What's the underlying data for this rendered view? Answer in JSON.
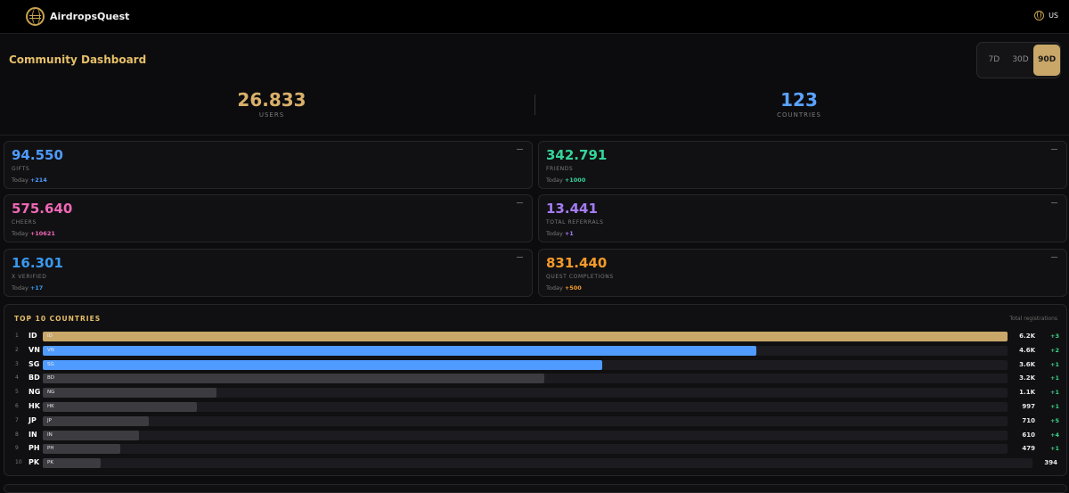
{
  "app": {
    "name": "AirdropsQuest",
    "language": "US"
  },
  "dashboard": {
    "title": "Community Dashboard",
    "periods": [
      "7D",
      "30D",
      "90D"
    ],
    "active_period": "90D"
  },
  "hero": {
    "users": {
      "value": "26.833",
      "label": "USERS",
      "color": "#d9b06a"
    },
    "countries": {
      "value": "123",
      "label": "COUNTRIES",
      "color": "#5aa2ff"
    }
  },
  "stats": [
    {
      "value": "94.550",
      "label": "GIFTS",
      "today_label": "Today",
      "today": "+214",
      "color": "#4f9bff"
    },
    {
      "value": "342.791",
      "label": "FRIENDS",
      "today_label": "Today",
      "today": "+1000",
      "color": "#35d59a"
    },
    {
      "value": "575.640",
      "label": "CHEERS",
      "today_label": "Today",
      "today": "+10621",
      "color": "#f067b6"
    },
    {
      "value": "13.441",
      "label": "TOTAL REFERRALS",
      "today_label": "Today",
      "today": "+1",
      "color": "#a57cf5"
    },
    {
      "value": "16.301",
      "label": "X VERIFIED",
      "today_label": "Today",
      "today": "+17",
      "color": "#3a98f0"
    },
    {
      "value": "831.440",
      "label": "QUEST COMPLETIONS",
      "today_label": "Today",
      "today": "+500",
      "color": "#f59a2a"
    }
  ],
  "top_countries": {
    "title": "TOP 10 COUNTRIES",
    "subtitle": "Total registrations",
    "rows": [
      {
        "rank": "1",
        "code": "ID",
        "value": "6.2K",
        "change": "+3",
        "fraction": 1.0,
        "color": "#c9a768"
      },
      {
        "rank": "2",
        "code": "VN",
        "value": "4.6K",
        "change": "+2",
        "fraction": 0.74,
        "color": "#4f9bff"
      },
      {
        "rank": "3",
        "code": "SG",
        "value": "3.6K",
        "change": "+1",
        "fraction": 0.58,
        "color": "#4f9bff"
      },
      {
        "rank": "4",
        "code": "BD",
        "value": "3.2K",
        "change": "+1",
        "fraction": 0.52,
        "color": "#3c3c40"
      },
      {
        "rank": "5",
        "code": "NG",
        "value": "1.1K",
        "change": "+1",
        "fraction": 0.18,
        "color": "#3c3c40"
      },
      {
        "rank": "6",
        "code": "HK",
        "value": "997",
        "change": "+1",
        "fraction": 0.16,
        "color": "#3c3c40"
      },
      {
        "rank": "7",
        "code": "JP",
        "value": "710",
        "change": "+5",
        "fraction": 0.11,
        "color": "#3c3c40"
      },
      {
        "rank": "8",
        "code": "IN",
        "value": "610",
        "change": "+4",
        "fraction": 0.1,
        "color": "#3c3c40"
      },
      {
        "rank": "9",
        "code": "PH",
        "value": "479",
        "change": "+1",
        "fraction": 0.08,
        "color": "#3c3c40"
      },
      {
        "rank": "10",
        "code": "PK",
        "value": "394",
        "change": "",
        "fraction": 0.06,
        "color": "#3c3c40"
      }
    ]
  }
}
